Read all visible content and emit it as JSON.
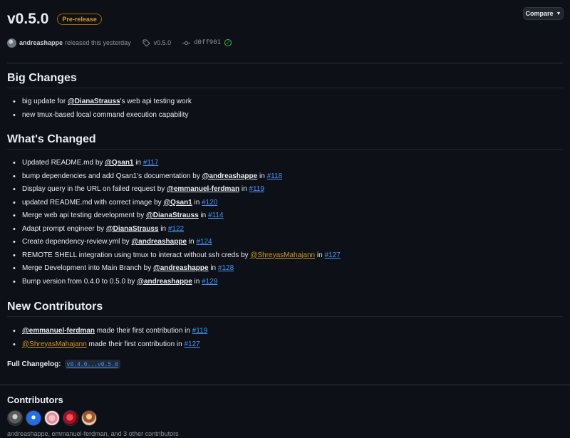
{
  "release": {
    "title": "v0.5.0",
    "badge": "Pre-release",
    "compare_label": "Compare",
    "author": "andreashappe",
    "released_text": "released this yesterday",
    "tag": "v0.5.0",
    "commit": "d0ff901"
  },
  "big_changes": {
    "heading": "Big Changes",
    "item1_pre": "big update for ",
    "item1_mention": "@DianaStrauss",
    "item1_post": "'s web api testing work",
    "item2": "new tmux-based local command execution capability"
  },
  "whats_changed": {
    "heading": "What's Changed",
    "items": [
      {
        "text": "Updated README.md by ",
        "user": "@Qsan1",
        "pr": "#117"
      },
      {
        "text": "bump dependencies and add Qsan1's documentation by ",
        "user": "@andreashappe",
        "pr": "#118"
      },
      {
        "text": "Display query in the URL on failed request by ",
        "user": "@emmanuel-ferdman",
        "pr": "#119"
      },
      {
        "text": "updated README.md with correct image by ",
        "user": "@Qsan1",
        "pr": "#120"
      },
      {
        "text": "Merge web api testing development by ",
        "user": "@DianaStrauss",
        "pr": "#114"
      },
      {
        "text": "Adapt prompt engineer by ",
        "user": "@DianaStrauss",
        "pr": "#122"
      },
      {
        "text": "Create dependency-review.yml by ",
        "user": "@andreashappe",
        "pr": "#124"
      },
      {
        "text": "REMOTE SHELL integration using tmux to interact without ssh creds by ",
        "user": "@ShreyasMahajann",
        "pr": "#127"
      },
      {
        "text": "Merge Development into Main Branch by ",
        "user": "@andreashappe",
        "pr": "#128"
      },
      {
        "text": "Bump version from 0.4.0 to 0.5.0 by ",
        "user": "@andreashappe",
        "pr": "#129"
      }
    ],
    "in_word": " in "
  },
  "new_contributors": {
    "heading": "New Contributors",
    "items": [
      {
        "user": "@emmanuel-ferdman",
        "text": " made their first contribution in ",
        "pr": "#119"
      },
      {
        "user": "@ShreyasMahajann",
        "text": " made their first contribution in ",
        "pr": "#127"
      }
    ]
  },
  "changelog": {
    "label": "Full Changelog:",
    "link": "v0.4.0...v0.5.0"
  },
  "contributors": {
    "heading": "Contributors",
    "names": "andreashappe, emmanuel-ferdman, and 3 other contributors"
  },
  "colors": {
    "background": "#0d1117",
    "link": "#4493f8",
    "prerelease": "#d29922",
    "check": "#3fb950"
  }
}
